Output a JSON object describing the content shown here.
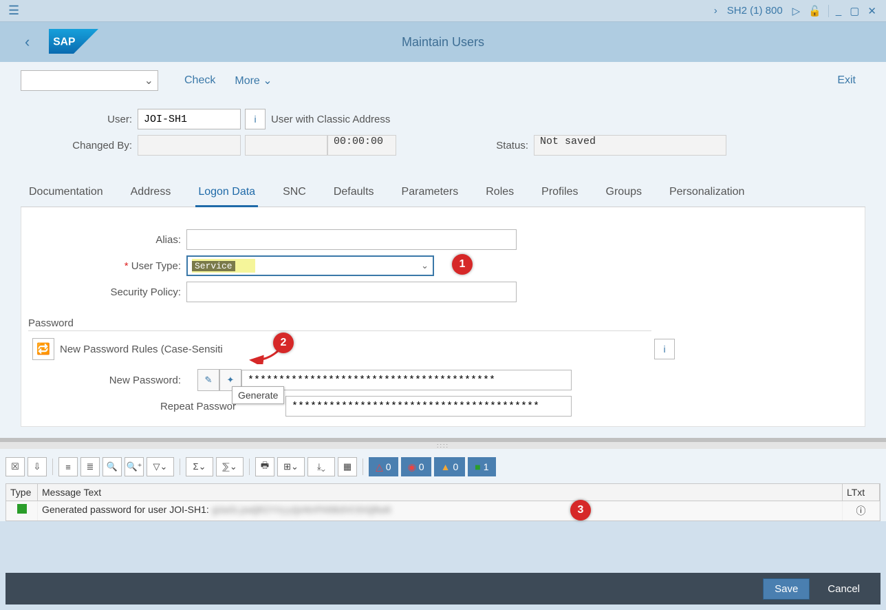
{
  "systembar": {
    "session": "SH2 (1) 800"
  },
  "header": {
    "title": "Maintain Users"
  },
  "toolbar": {
    "check": "Check",
    "more": "More",
    "exit": "Exit"
  },
  "form": {
    "user_label": "User:",
    "user_value": "JOI-SH1",
    "user_caption": "User with Classic Address",
    "changed_label": "Changed By:",
    "changed_by": "",
    "changed_date": "",
    "changed_time": "00:00:00",
    "status_label": "Status:",
    "status_value": "Not saved"
  },
  "tabs": {
    "items": [
      "Documentation",
      "Address",
      "Logon Data",
      "SNC",
      "Defaults",
      "Parameters",
      "Roles",
      "Profiles",
      "Groups",
      "Personalization"
    ],
    "active": 2
  },
  "logon": {
    "alias_label": "Alias:",
    "alias_value": "",
    "usertype_label": "User Type:",
    "usertype_value": "Service",
    "secpol_label": "Security Policy:",
    "secpol_value": "",
    "password_section": "Password",
    "rules_text": "New Password Rules (Case-Sensitive)",
    "newpw_label": "New Password:",
    "newpw_value": "****************************************",
    "repeatpw_label": "Repeat Password:",
    "repeatpw_value": "****************************************",
    "generate_tooltip": "Generate"
  },
  "messages": {
    "headers": {
      "type": "Type",
      "text": "Message Text",
      "ltxt": "LTxt"
    },
    "counts": {
      "red": "0",
      "stop": "0",
      "warn": "0",
      "ok": "1"
    },
    "row": {
      "text_prefix": "Generated password for user JOI-SH1: ",
      "blurred": "gUwSLpwQR2YVyyQeNnPH8BdVC8XQRwN"
    }
  },
  "footer": {
    "save": "Save",
    "cancel": "Cancel"
  },
  "annotations": {
    "a1": "1",
    "a2": "2",
    "a3": "3"
  }
}
